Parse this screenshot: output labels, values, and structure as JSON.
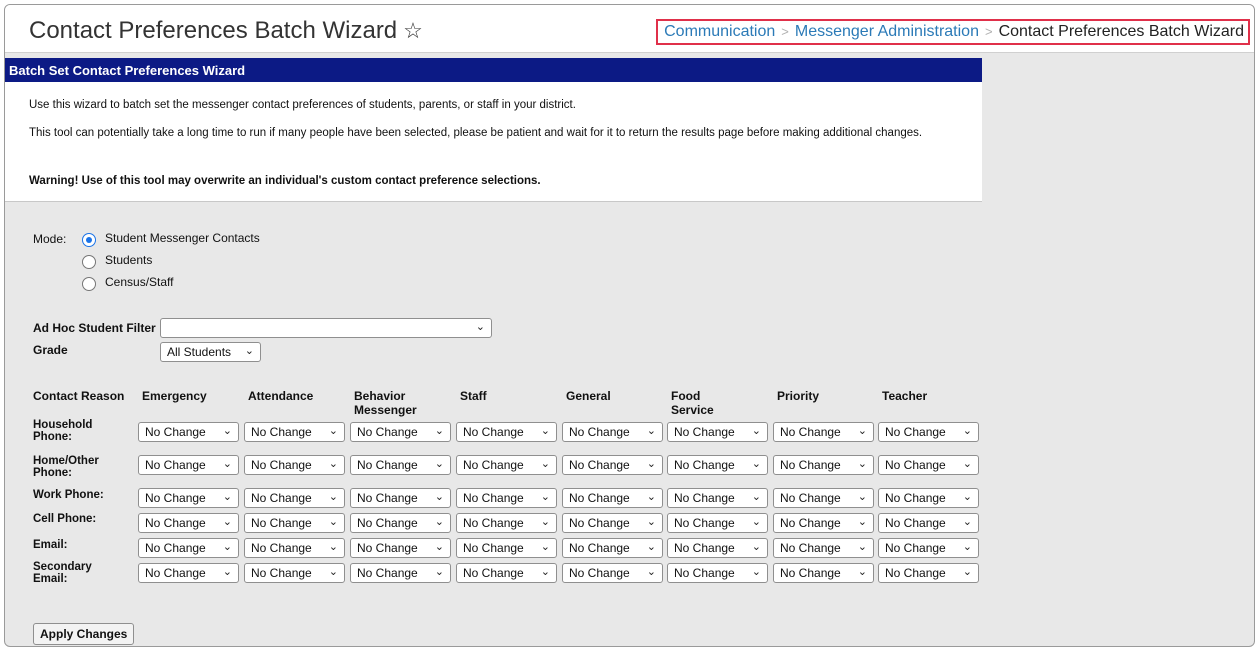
{
  "header": {
    "title": "Contact Preferences Batch Wizard",
    "breadcrumb": [
      "Communication",
      "Messenger Administration",
      "Contact Preferences Batch Wizard"
    ]
  },
  "panel": {
    "title": "Batch Set Contact Preferences Wizard",
    "intro": "Use this wizard to batch set the messenger contact preferences of students, parents, or staff in your district.",
    "note": "This tool can potentially take a long time to run if many people have been selected, please be patient and wait for it to return the results page before making additional changes.",
    "warning": "Warning! Use of this tool may overwrite an individual's custom contact preference selections."
  },
  "mode": {
    "label": "Mode:",
    "options": [
      "Student Messenger Contacts",
      "Students",
      "Census/Staff"
    ],
    "selected": "Student Messenger Contacts"
  },
  "filters": {
    "adhoc_label": "Ad Hoc Student Filter",
    "adhoc_value": "",
    "grade_label": "Grade",
    "grade_value": "All Students"
  },
  "table": {
    "corner": "Contact Reason",
    "columns": [
      "Emergency",
      "Attendance",
      "Behavior Messenger",
      "Staff",
      "General",
      "Food Service",
      "Priority",
      "Teacher"
    ],
    "rows": [
      "Household Phone:",
      "Home/Other Phone:",
      "Work Phone:",
      "Cell Phone:",
      "Email:",
      "Secondary Email:"
    ],
    "cell_value": "No Change"
  },
  "apply_label": "Apply Changes",
  "colors": {
    "panel_header": "#0c1a85",
    "breadcrumb_link": "#2b7ab7",
    "highlight_border": "#e0304a"
  }
}
